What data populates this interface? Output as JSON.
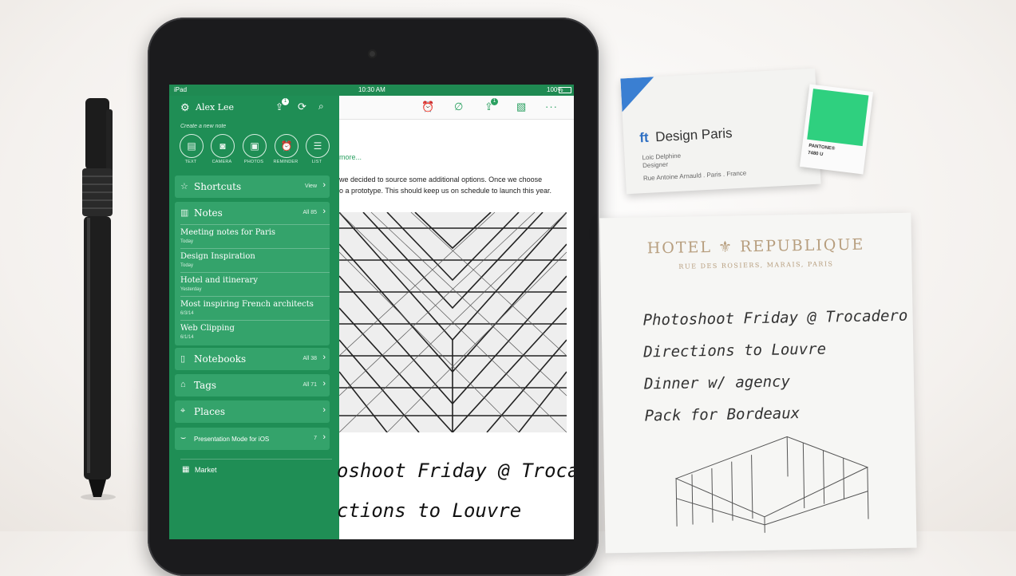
{
  "status_bar": {
    "carrier": "iPad",
    "time": "10:30 AM",
    "battery": "100%"
  },
  "sidebar": {
    "user_name": "Alex Lee",
    "sync_badge": "1",
    "create_label": "Create a new note",
    "create_buttons": [
      {
        "label": "TEXT",
        "icon": "text-note-icon"
      },
      {
        "label": "CAMERA",
        "icon": "camera-icon"
      },
      {
        "label": "PHOTOS",
        "icon": "photos-icon"
      },
      {
        "label": "REMINDER",
        "icon": "reminder-icon"
      },
      {
        "label": "LIST",
        "icon": "list-icon"
      }
    ],
    "shortcuts": {
      "label": "Shortcuts",
      "action": "View"
    },
    "notes": {
      "label": "Notes",
      "count": "All 85",
      "items": [
        {
          "title": "Meeting notes for Paris",
          "date": "Today"
        },
        {
          "title": "Design Inspiration",
          "date": "Today"
        },
        {
          "title": "Hotel and itinerary",
          "date": "Yesterday"
        },
        {
          "title": "Most inspiring French architects",
          "date": "6/3/14"
        },
        {
          "title": "Web Clipping",
          "date": "6/1/14"
        }
      ]
    },
    "notebooks": {
      "label": "Notebooks",
      "count": "All 38"
    },
    "tags": {
      "label": "Tags",
      "count": "All 71"
    },
    "places": {
      "label": "Places"
    },
    "presentation": {
      "label": "Presentation Mode for iOS",
      "count": "7"
    },
    "market": {
      "label": "Market"
    }
  },
  "note": {
    "more_link": "more...",
    "body_line1": "we decided to source some additional options. Once we choose",
    "body_line2": "o a prototype. This should keep us on schedule to launch this year.",
    "toolbar_badge": "1",
    "handwriting_line1": "oshoot Friday @ Trocadero",
    "handwriting_line2": "ctions to Louvre"
  },
  "business_card": {
    "logo": "ft",
    "company": "Design Paris",
    "person": "Loic Delphine",
    "role": "Designer",
    "address": "Rue Antoine Arnauld . Paris . France",
    "swatch_brand": "PANTONE®",
    "swatch_code": "7480 U",
    "swatch_color": "#2fd07f"
  },
  "hotel_paper": {
    "hotel_name": "HOTEL ⚜ REPUBLIQUE",
    "hotel_address": "RUE DES ROSIERS, MARAIS, PARIS",
    "lines": [
      "Photoshoot Friday @ Trocadero",
      "Directions to Louvre",
      "Dinner w/ agency",
      "Pack for Bordeaux"
    ]
  },
  "colors": {
    "sidebar": "#1f8e55",
    "card": "#34a36b",
    "accent": "#2aa060"
  }
}
